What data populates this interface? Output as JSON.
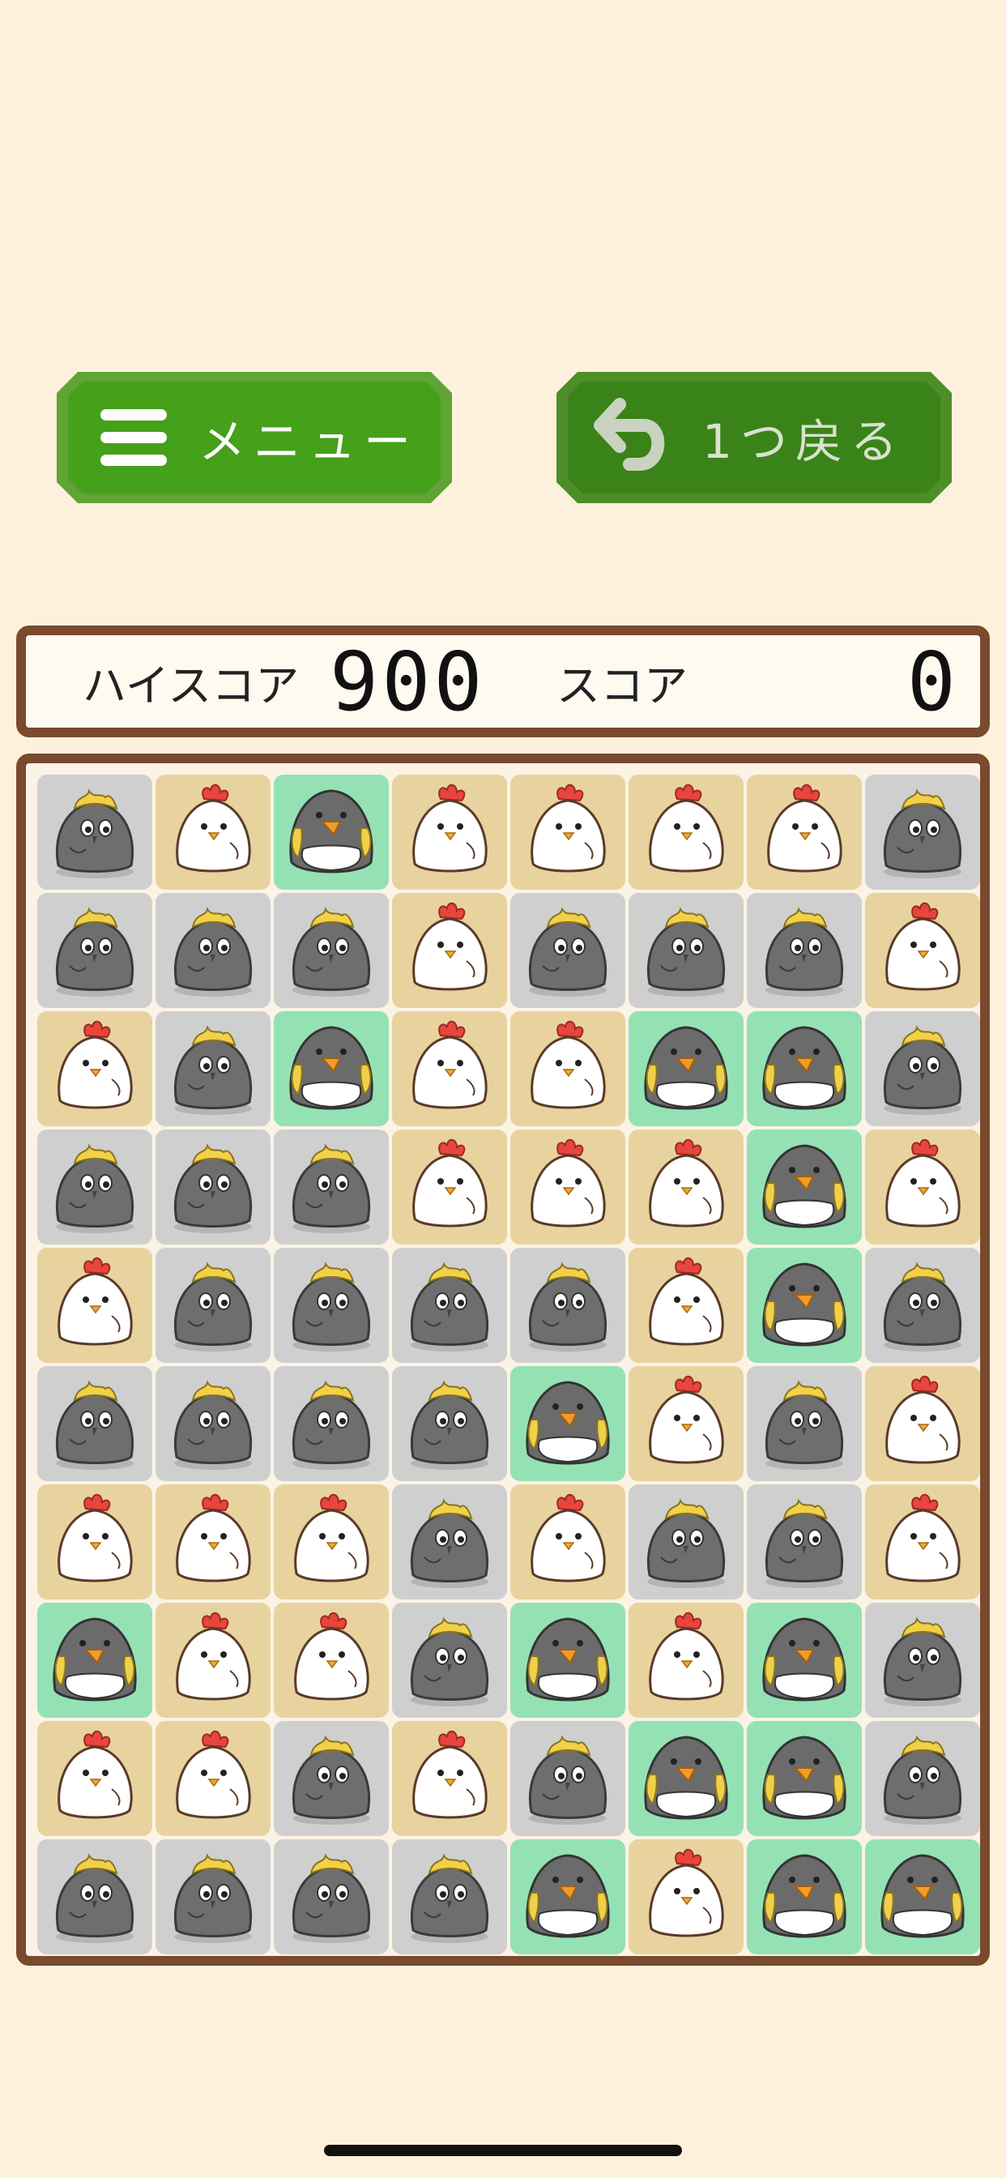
{
  "buttons": {
    "menu_label": "メニュー",
    "undo_label": "1つ戻る"
  },
  "score": {
    "high_label": "ハイスコア",
    "high_value": "900",
    "current_label": "スコア",
    "current_value": "0"
  },
  "colors": {
    "background": "#fdf1dd",
    "frame": "#7a4a2e",
    "menu_button": "#45a01a",
    "undo_button": "#3a8318",
    "tile_pigeon": "#cfcfcf",
    "tile_chicken": "#e8d39e",
    "tile_penguin": "#94e2b4"
  },
  "board": {
    "columns": 8,
    "rows": 10,
    "tiles": [
      [
        "pigeon",
        "chicken",
        "penguin",
        "chicken",
        "chicken",
        "chicken",
        "chicken",
        "pigeon"
      ],
      [
        "pigeon",
        "pigeon",
        "pigeon",
        "chicken",
        "pigeon",
        "pigeon",
        "pigeon",
        "chicken"
      ],
      [
        "chicken",
        "pigeon",
        "penguin",
        "chicken",
        "chicken",
        "penguin",
        "penguin",
        "pigeon"
      ],
      [
        "pigeon",
        "pigeon",
        "pigeon",
        "chicken",
        "chicken",
        "chicken",
        "penguin",
        "chicken"
      ],
      [
        "chicken",
        "pigeon",
        "pigeon",
        "pigeon",
        "pigeon",
        "chicken",
        "penguin",
        "pigeon"
      ],
      [
        "pigeon",
        "pigeon",
        "pigeon",
        "pigeon",
        "penguin",
        "chicken",
        "pigeon",
        "chicken"
      ],
      [
        "chicken",
        "chicken",
        "chicken",
        "pigeon",
        "chicken",
        "pigeon",
        "pigeon",
        "chicken"
      ],
      [
        "penguin",
        "chicken",
        "chicken",
        "pigeon",
        "penguin",
        "chicken",
        "penguin",
        "pigeon"
      ],
      [
        "chicken",
        "chicken",
        "pigeon",
        "chicken",
        "pigeon",
        "penguin",
        "penguin",
        "pigeon"
      ],
      [
        "pigeon",
        "pigeon",
        "pigeon",
        "pigeon",
        "penguin",
        "chicken",
        "penguin",
        "penguin"
      ]
    ]
  }
}
